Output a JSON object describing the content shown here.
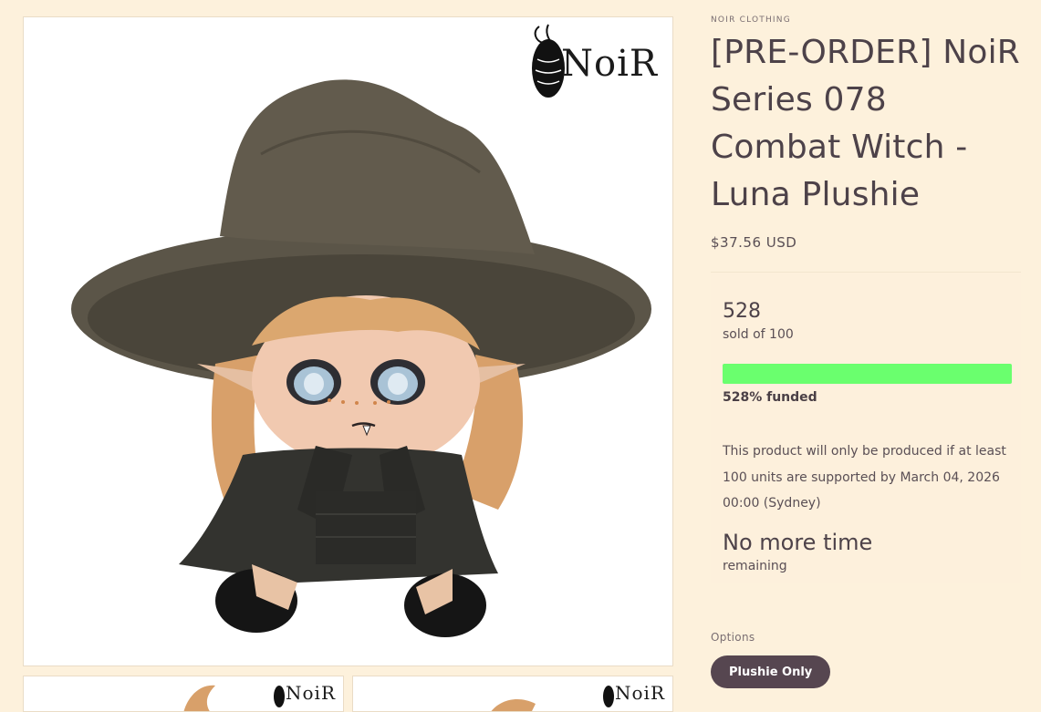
{
  "product": {
    "vendor": "NOIR CLOTHING",
    "title": "[PRE-ORDER] NoiR Series 078 Combat Witch - Luna Plushie",
    "price": "$37.56 USD"
  },
  "gallery": {
    "main_image_alt": "Combat Witch Luna plushie wearing a large brown witch hat",
    "logo_text": "NoiR",
    "thumbnails": [
      {
        "logo_text": "NoiR"
      },
      {
        "logo_text": "NoiR"
      }
    ]
  },
  "crowdfunding": {
    "sold_count": "528",
    "sold_of": "sold of 100",
    "progress_fraction": 1.0,
    "progress_color": "#6aff6e",
    "funded_text": "528% funded",
    "note": "This product will only be produced if at least 100 units are supported by March 04, 2026 00:00 (Sydney)",
    "time_status": "No more time",
    "time_label": "remaining"
  },
  "options": {
    "label": "Options",
    "selected": "Plushie Only"
  },
  "colors": {
    "page_background": "#fdf1dc",
    "text": "#4d4249",
    "option_pill": "#564650"
  }
}
